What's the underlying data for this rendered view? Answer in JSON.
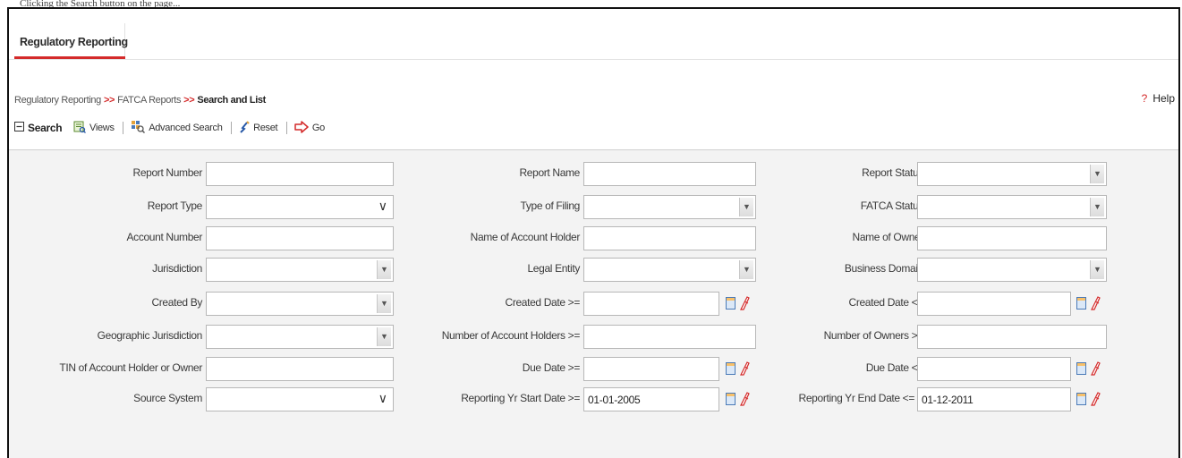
{
  "caption": "Clicking the Search button on the page...",
  "tab": {
    "label": "Regulatory Reporting"
  },
  "breadcrumb": {
    "root": "Regulatory Reporting",
    "section": "FATCA Reports",
    "current": "Search and List",
    "separator": ">>"
  },
  "help": {
    "label": "Help",
    "icon": "question-icon"
  },
  "toolbar": {
    "search": "Search",
    "views": "Views",
    "advanced_search": "Advanced Search",
    "reset": "Reset",
    "go": "Go"
  },
  "fields": {
    "report_number": {
      "label": "Report Number",
      "value": ""
    },
    "report_name": {
      "label": "Report Name",
      "value": ""
    },
    "report_status": {
      "label": "Report Status",
      "value": ""
    },
    "report_type": {
      "label": "Report Type",
      "value": ""
    },
    "type_of_filing": {
      "label": "Type of Filing",
      "value": ""
    },
    "fatca_status": {
      "label": "FATCA Status",
      "value": ""
    },
    "account_number": {
      "label": "Account Number",
      "value": ""
    },
    "name_of_account_holder": {
      "label": "Name of Account Holder",
      "value": ""
    },
    "name_of_owner": {
      "label": "Name of Owner",
      "value": ""
    },
    "jurisdiction": {
      "label": "Jurisdiction",
      "value": ""
    },
    "legal_entity": {
      "label": "Legal Entity",
      "value": ""
    },
    "business_domain": {
      "label": "Business Domain",
      "value": ""
    },
    "created_by": {
      "label": "Created By",
      "value": ""
    },
    "created_date_from": {
      "label": "Created Date >=",
      "value": ""
    },
    "created_date_to": {
      "label": "Created Date <=",
      "value": ""
    },
    "geographic_jurisdiction": {
      "label": "Geographic Jurisdiction",
      "value": ""
    },
    "number_of_account_holders": {
      "label": "Number of Account Holders >=",
      "value": ""
    },
    "number_of_owners": {
      "label": "Number of Owners >=",
      "value": ""
    },
    "tin": {
      "label": "TIN of Account Holder or Owner",
      "value": ""
    },
    "due_date_from": {
      "label": "Due Date >=",
      "value": ""
    },
    "due_date_to": {
      "label": "Due Date <=",
      "value": ""
    },
    "source_system": {
      "label": "Source System",
      "value": ""
    },
    "reporting_yr_start": {
      "label": "Reporting Yr Start Date >=",
      "value": "01-01-2005"
    },
    "reporting_yr_end": {
      "label": "Reporting Yr End Date <=",
      "value": "01-12-2011"
    }
  },
  "colors": {
    "accent_red": "#d42a2a",
    "panel_bg": "#f3f3f3",
    "input_border": "#b7b7b7"
  }
}
